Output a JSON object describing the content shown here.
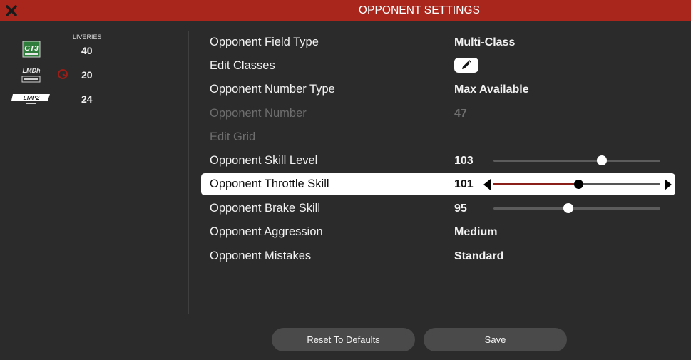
{
  "window": {
    "title": "OPPONENT SETTINGS"
  },
  "liveries": {
    "header": "LIVERIES",
    "classes": [
      {
        "logo_text": "GT3",
        "count": "40"
      },
      {
        "logo_text": "LMDh",
        "count": "20"
      },
      {
        "logo_text": "LMP2",
        "count": "24"
      }
    ]
  },
  "settings": {
    "field_type": {
      "label": "Opponent Field Type",
      "value": "Multi-Class"
    },
    "edit_classes": {
      "label": "Edit Classes"
    },
    "number_type": {
      "label": "Opponent Number Type",
      "value": "Max Available"
    },
    "number": {
      "label": "Opponent Number",
      "value": "47"
    },
    "edit_grid": {
      "label": "Edit Grid"
    },
    "skill_level": {
      "label": "Opponent Skill Level",
      "value": "103",
      "level": 0.65
    },
    "throttle_skill": {
      "label": "Opponent Throttle Skill",
      "value": "101",
      "level": 0.51
    },
    "brake_skill": {
      "label": "Opponent Brake Skill",
      "value": "95",
      "level": 0.45
    },
    "aggression": {
      "label": "Opponent Aggression",
      "value": "Medium"
    },
    "mistakes": {
      "label": "Opponent Mistakes",
      "value": "Standard"
    }
  },
  "buttons": {
    "reset": "Reset To Defaults",
    "save": "Save"
  },
  "colors": {
    "titlebar": "#a8261c",
    "background": "#2b2b2b",
    "slider_fill_active": "#8a1f1a"
  },
  "icons": {
    "close": "close-x-icon",
    "edit": "pencil-icon"
  }
}
